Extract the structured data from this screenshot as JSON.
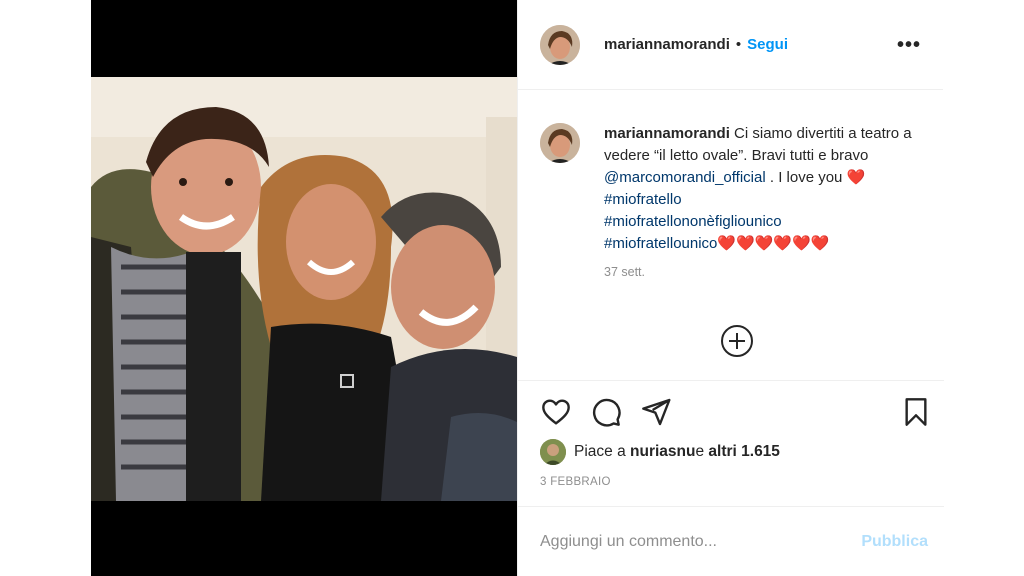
{
  "post": {
    "header": {
      "username": "mariannamorandi",
      "separator": "•",
      "follow_label": "Segui",
      "more_icon": "more-horizontal-icon"
    },
    "caption": {
      "username": "mariannamorandi",
      "text_1": "Ci siamo divertiti a teatro a vedere “il letto ovale”. Bravi tutti e bravo",
      "mention": "@marcomorandi_official",
      "text_2": " . I love you",
      "heart": "❤️",
      "hashtag_1": "#miofratello",
      "hashtag_2": "#miofratellononèfigliounico",
      "hashtag_3": "#miofratellounico",
      "hearts_trail": "❤️❤️❤️❤️❤️❤️",
      "time": "37 sett."
    },
    "load_more_icon": "plus-circle-icon",
    "actions": {
      "like_icon": "heart-icon",
      "comment_icon": "comment-icon",
      "share_icon": "paper-plane-icon",
      "save_icon": "bookmark-icon"
    },
    "likes": {
      "prefix": "Piace a ",
      "user": "nuriasnu",
      "middle": " e ",
      "others": "altri 1.615"
    },
    "date": "3 FEBBRAIO",
    "comment_box": {
      "placeholder": "Aggiungi un commento...",
      "publish_label": "Pubblica"
    },
    "colors": {
      "accent": "#0095f6",
      "text": "#262626",
      "muted": "#8e8e8e",
      "hashtag": "#00376b",
      "publish_disabled": "#b2dffc",
      "border": "#efefef"
    }
  }
}
